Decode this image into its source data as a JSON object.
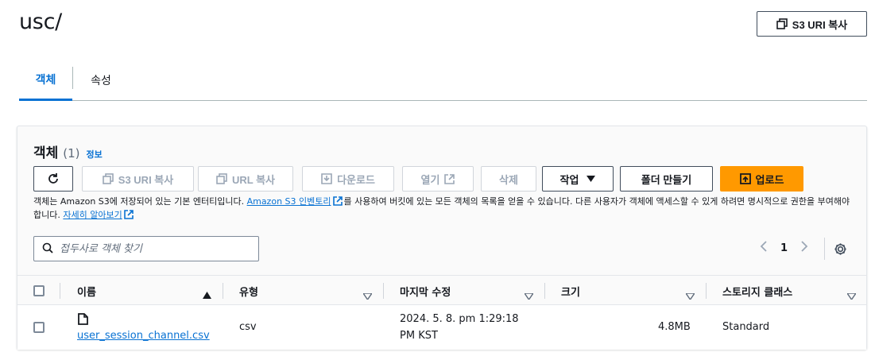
{
  "page": {
    "title": "usc/",
    "copy_uri_label": "S3 URI 복사"
  },
  "tabs": [
    {
      "label": "객체"
    },
    {
      "label": "속성"
    }
  ],
  "objects_panel": {
    "title": "객체",
    "count": "(1)",
    "info": "정보",
    "toolbar": {
      "copy_uri": "S3 URI 복사",
      "copy_url": "URL 복사",
      "download": "다운로드",
      "open": "열기",
      "delete": "삭제",
      "actions": "작업",
      "create_folder": "폴더 만들기",
      "upload": "업로드"
    },
    "description": {
      "part1": "객체는 Amazon S3에 저장되어 있는 기본 엔터티입니다. ",
      "link1": "Amazon S3 인벤토리",
      "part2": "를 사용하여 버킷에 있는 모든 객체의 목록을 얻을 수 있습니다. 다른 사용자가 객체에 액세스할 수 있게 하려면 명시적으로 권한을 부여해야 합니다. ",
      "link2": "자세히 알아보기"
    },
    "search": {
      "placeholder": "접두사로 객체 찾기"
    },
    "pagination": {
      "current_page": "1"
    },
    "table": {
      "columns": {
        "name": "이름",
        "type": "유형",
        "last_modified": "마지막 수정",
        "size": "크기",
        "storage_class": "스토리지 클래스"
      },
      "rows": [
        {
          "name": "user_session_channel.csv",
          "type": "csv",
          "last_modified_line1": "2024. 5. 8. pm 1:29:18",
          "last_modified_line2": "PM KST",
          "size": "4.8MB",
          "storage_class": "Standard"
        }
      ]
    }
  },
  "colors": {
    "accent": "#0972d3",
    "primary_button": "#ff9900",
    "text": "#16191f",
    "disabled": "#9ba7b6"
  },
  "icons": [
    "copy-icon",
    "refresh-icon",
    "download-icon",
    "external-link-icon",
    "caret-down-icon",
    "folder-upload-icon",
    "search-icon",
    "chevron-left-icon",
    "chevron-right-icon",
    "gear-icon",
    "sort-asc-icon",
    "sort-icon",
    "file-icon"
  ]
}
